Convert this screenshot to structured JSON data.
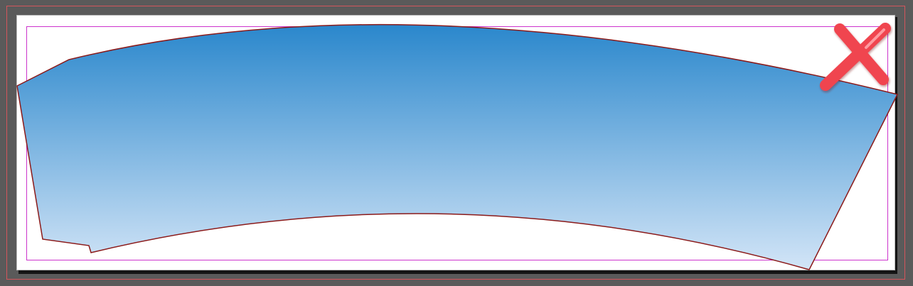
{
  "canvas": {
    "pasteboard_color": "#5a5a5a",
    "page_color": "#ffffff",
    "bleed_guide_color": "#d4555c",
    "margin_guide_color": "#cc33cc"
  },
  "artwork": {
    "shape": "cup-wrapper-arc",
    "fill_gradient": {
      "top_color": "#2a87cc",
      "bottom_color": "#d3e5f7"
    },
    "stroke_color": "#8b1a1a"
  },
  "reject_mark": {
    "icon": "red-x-icon",
    "color": "#f0444f",
    "highlight_color": "#ff9aa0"
  }
}
